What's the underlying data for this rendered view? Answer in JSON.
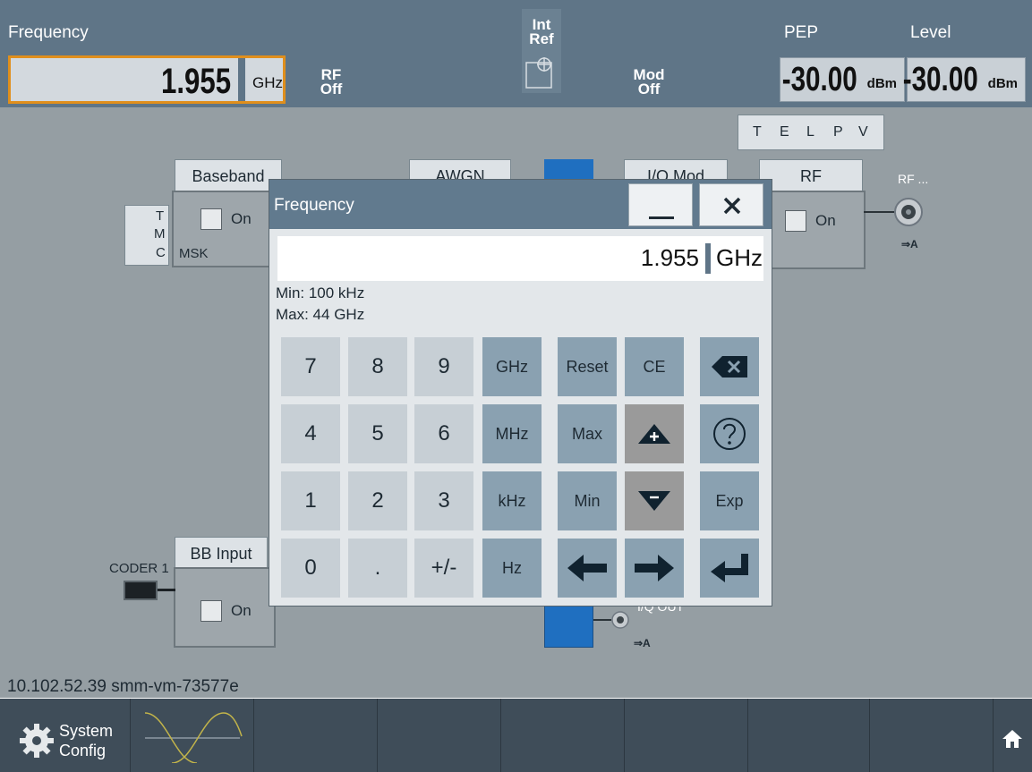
{
  "topbar": {
    "frequency_label": "Frequency",
    "frequency_value": "1.955",
    "frequency_unit": "GHz",
    "rf_btn_line1": "RF",
    "rf_btn_line2": "Off",
    "intref_line1": "Int",
    "intref_line2": "Ref",
    "mod_line1": "Mod",
    "mod_line2": "Off",
    "pep_label": "PEP",
    "pep_value": "-30.00",
    "pep_unit": "dBm",
    "level_label": "Level",
    "level_value": "-30.00",
    "level_unit": "dBm"
  },
  "diagram": {
    "telpv": [
      "T",
      "E",
      "L",
      "P",
      "V"
    ],
    "tmc": [
      "T",
      "M",
      "C"
    ],
    "baseband_title": "Baseband",
    "baseband_on": "On",
    "baseband_mod": "MSK",
    "awgn_title": "AWGN",
    "iqmod_title": "I/Q Mod",
    "rf_title": "RF",
    "rf_on": "On",
    "rf_connector_label": "RF ...",
    "rf_connector_sub": "⇒A",
    "bbinput_title": "BB Input",
    "bbinput_on": "On",
    "coder_label": "CODER 1",
    "iqout_label": "I/Q OUT",
    "iqout_sub": "⇒A",
    "ip_label": "10.102.52.39 smm-vm-73577e"
  },
  "taskbar": {
    "system_config_line1": "System",
    "system_config_line2": "Config"
  },
  "dialog": {
    "title": "Frequency",
    "input_value": "1.955",
    "input_unit": "GHz",
    "min_label": "Min: 100 kHz",
    "max_label": "Max: 44 GHz",
    "keys": {
      "k7": "7",
      "k8": "8",
      "k9": "9",
      "ghz": "GHz",
      "reset": "Reset",
      "ce": "CE",
      "k4": "4",
      "k5": "5",
      "k6": "6",
      "mhz": "MHz",
      "max": "Max",
      "k1": "1",
      "k2": "2",
      "k3": "3",
      "khz": "kHz",
      "min": "Min",
      "exp": "Exp",
      "k0": "0",
      "dot": ".",
      "sign": "+/-",
      "hz": "Hz"
    }
  },
  "colors": {
    "header_bg": "#5f7587",
    "active_border": "#e08f1c",
    "iq_highlight": "#1f6fc0",
    "digit_key": "#c7cfd5",
    "unit_key": "#8aa1b1",
    "taskbar_bg": "#3f4d59"
  },
  "icons": [
    "minimize-icon",
    "close-icon",
    "backspace-icon",
    "help-icon",
    "step-up-icon",
    "step-down-icon",
    "arrow-left-icon",
    "arrow-right-icon",
    "enter-icon",
    "gear-icon",
    "home-icon",
    "sine-wave-icon"
  ]
}
